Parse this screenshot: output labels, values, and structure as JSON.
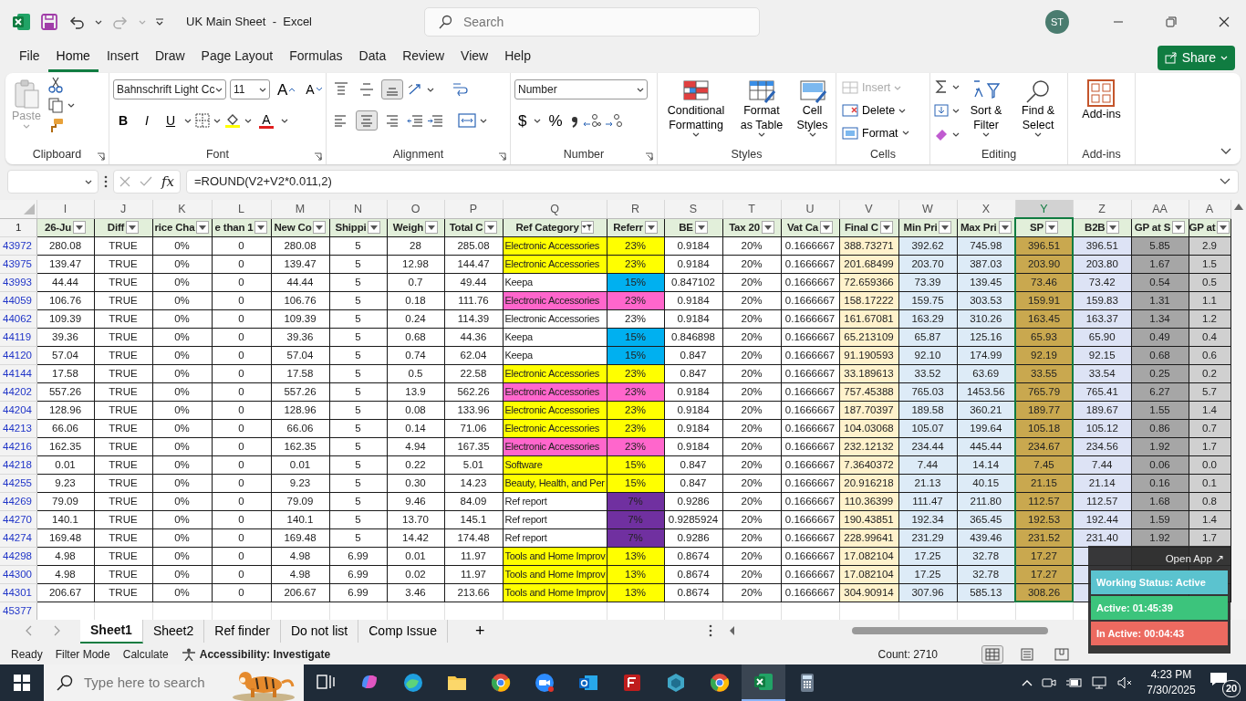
{
  "title_bar": {
    "title": "UK Main Sheet  -  Excel",
    "search_placeholder": "Search",
    "account_initials": "ST"
  },
  "menu": [
    {
      "label": "File",
      "selected": false
    },
    {
      "label": "Home",
      "selected": true
    },
    {
      "label": "Insert",
      "selected": false
    },
    {
      "label": "Draw",
      "selected": false
    },
    {
      "label": "Page Layout",
      "selected": false
    },
    {
      "label": "Formulas",
      "selected": false
    },
    {
      "label": "Data",
      "selected": false
    },
    {
      "label": "Review",
      "selected": false
    },
    {
      "label": "View",
      "selected": false
    },
    {
      "label": "Help",
      "selected": false
    }
  ],
  "share": "Share",
  "ribbon": {
    "groups": [
      {
        "label": "Clipboard"
      },
      {
        "label": "Font"
      },
      {
        "label": "Alignment"
      },
      {
        "label": "Number"
      },
      {
        "label": "Styles"
      },
      {
        "label": "Cells"
      },
      {
        "label": "Editing"
      },
      {
        "label": "Add-ins"
      }
    ],
    "paste": "Paste",
    "font_name": "Bahnschrift Light Cc",
    "font_size": "11",
    "size_buttons": [
      "A",
      "A"
    ],
    "font_styles": [
      "B",
      "I",
      "U"
    ],
    "font_color": "A",
    "vertical_align": [
      {
        "selected": false
      },
      {
        "selected": false
      },
      {
        "selected": true
      }
    ],
    "horizontal_align": [
      {
        "selected": false
      },
      {
        "selected": true
      },
      {
        "selected": false
      }
    ],
    "number_format": "Number",
    "currency": "$",
    "percent": "%",
    "styles": [
      {
        "label": "Conditional Formatting"
      },
      {
        "label": "Format as Table"
      },
      {
        "label": "Cell Styles"
      }
    ],
    "cells": [
      {
        "label": "Insert",
        "disabled": true
      },
      {
        "label": "Delete",
        "disabled": false
      },
      {
        "label": "Format",
        "disabled": false
      }
    ],
    "editing": [
      {
        "label": "Sort & Filter"
      },
      {
        "label": "Find & Select"
      }
    ],
    "addins": "Add-ins"
  },
  "formula_bar": {
    "function_label": "fx",
    "formula": "=ROUND(V2+V2*0.011,2)"
  },
  "grid": {
    "columns": [
      {
        "letter": "I",
        "header": "26-Ju",
        "filtered": false,
        "selected": false
      },
      {
        "letter": "J",
        "header": "Diff",
        "filtered": false,
        "selected": false
      },
      {
        "letter": "K",
        "header": "rice Cha",
        "filtered": false,
        "selected": false
      },
      {
        "letter": "L",
        "header": "e than 1",
        "filtered": false,
        "selected": false
      },
      {
        "letter": "M",
        "header": "New Co",
        "filtered": false,
        "selected": false
      },
      {
        "letter": "N",
        "header": "Shippi",
        "filtered": false,
        "selected": false
      },
      {
        "letter": "O",
        "header": "Weigh",
        "filtered": false,
        "selected": false
      },
      {
        "letter": "P",
        "header": "Total C",
        "filtered": false,
        "selected": false
      },
      {
        "letter": "Q",
        "header": "Ref Category",
        "filtered": true,
        "selected": false
      },
      {
        "letter": "R",
        "header": "Referr",
        "filtered": false,
        "selected": false
      },
      {
        "letter": "S",
        "header": "BE",
        "filtered": false,
        "selected": false
      },
      {
        "letter": "T",
        "header": "Tax 20",
        "filtered": false,
        "selected": false
      },
      {
        "letter": "U",
        "header": "Vat Ca",
        "filtered": false,
        "selected": false
      },
      {
        "letter": "V",
        "header": "Final C",
        "filtered": false,
        "selected": false,
        "color": "#fff2cc"
      },
      {
        "letter": "W",
        "header": "Min Pri",
        "filtered": false,
        "selected": false,
        "color": "#ddebf7"
      },
      {
        "letter": "X",
        "header": "Max Pri",
        "filtered": false,
        "selected": false,
        "color": "#ddebf7"
      },
      {
        "letter": "Y",
        "header": "SP",
        "filtered": false,
        "selected": true,
        "color": "#c9a84f"
      },
      {
        "letter": "Z",
        "header": "B2B",
        "filtered": false,
        "selected": false,
        "color": "#dde3f5"
      },
      {
        "letter": "AA",
        "header": "GP at S",
        "filtered": false,
        "selected": false,
        "color": "#a6a6a6"
      },
      {
        "letter": "A",
        "header": "GP at",
        "filtered": false,
        "selected": false,
        "color": "#d0d0d0"
      }
    ],
    "header_row": "1",
    "rows": [
      {
        "number": "43972",
        "cells": [
          "280.08",
          "TRUE",
          "0%",
          "0",
          "280.08",
          "5",
          "28",
          "285.08",
          {
            "text": "Electronic Accessories",
            "color": "#ffff00"
          },
          {
            "text": "23%",
            "color": "#ffff00"
          },
          "0.9184",
          "20%",
          "0.1666667",
          "388.73271",
          "392.62",
          "745.98",
          "396.51",
          "396.51",
          "5.85",
          "2.9"
        ]
      },
      {
        "number": "43975",
        "cells": [
          "139.47",
          "TRUE",
          "0%",
          "0",
          "139.47",
          "5",
          "12.98",
          "144.47",
          {
            "text": "Electronic Accessories",
            "color": "#ffff00"
          },
          {
            "text": "23%",
            "color": "#ffff00"
          },
          "0.9184",
          "20%",
          "0.1666667",
          "201.68499",
          "203.70",
          "387.03",
          "203.90",
          "203.80",
          "1.67",
          "1.5"
        ]
      },
      {
        "number": "43993",
        "cells": [
          "44.44",
          "TRUE",
          "0%",
          "0",
          "44.44",
          "5",
          "0.7",
          "49.44",
          {
            "text": "Keepa"
          },
          {
            "text": "15%",
            "color": "#00b0f0"
          },
          "0.847102",
          "20%",
          "0.1666667",
          "72.659366",
          "73.39",
          "139.45",
          "73.46",
          "73.42",
          "0.54",
          "0.5"
        ]
      },
      {
        "number": "44059",
        "cells": [
          "106.76",
          "TRUE",
          "0%",
          "0",
          "106.76",
          "5",
          "0.18",
          "111.76",
          {
            "text": "Electronic Accessories",
            "color": "#ff66cc"
          },
          {
            "text": "23%",
            "color": "#ff66cc"
          },
          "0.9184",
          "20%",
          "0.1666667",
          "158.17222",
          "159.75",
          "303.53",
          "159.91",
          "159.83",
          "1.31",
          "1.1"
        ]
      },
      {
        "number": "44062",
        "cells": [
          "109.39",
          "TRUE",
          "0%",
          "0",
          "109.39",
          "5",
          "0.24",
          "114.39",
          {
            "text": "Electronic Accessories"
          },
          {
            "text": "23%"
          },
          "0.9184",
          "20%",
          "0.1666667",
          "161.67081",
          "163.29",
          "310.26",
          "163.45",
          "163.37",
          "1.34",
          "1.2"
        ]
      },
      {
        "number": "44119",
        "cells": [
          "39.36",
          "TRUE",
          "0%",
          "0",
          "39.36",
          "5",
          "0.68",
          "44.36",
          {
            "text": "Keepa"
          },
          {
            "text": "15%",
            "color": "#00b0f0"
          },
          "0.846898",
          "20%",
          "0.1666667",
          "65.213109",
          "65.87",
          "125.16",
          "65.93",
          "65.90",
          "0.49",
          "0.4"
        ]
      },
      {
        "number": "44120",
        "cells": [
          "57.04",
          "TRUE",
          "0%",
          "0",
          "57.04",
          "5",
          "0.74",
          "62.04",
          {
            "text": "Keepa"
          },
          {
            "text": "15%",
            "color": "#00b0f0"
          },
          "0.847",
          "20%",
          "0.1666667",
          "91.190593",
          "92.10",
          "174.99",
          "92.19",
          "92.15",
          "0.68",
          "0.6"
        ]
      },
      {
        "number": "44144",
        "cells": [
          "17.58",
          "TRUE",
          "0%",
          "0",
          "17.58",
          "5",
          "0.5",
          "22.58",
          {
            "text": "Electronic Accessories",
            "color": "#ffff00"
          },
          {
            "text": "23%",
            "color": "#ffff00"
          },
          "0.847",
          "20%",
          "0.1666667",
          "33.189613",
          "33.52",
          "63.69",
          "33.55",
          "33.54",
          "0.25",
          "0.2"
        ]
      },
      {
        "number": "44202",
        "cells": [
          "557.26",
          "TRUE",
          "0%",
          "0",
          "557.26",
          "5",
          "13.9",
          "562.26",
          {
            "text": "Electronic Accessories",
            "color": "#ff66cc"
          },
          {
            "text": "23%",
            "color": "#ff66cc"
          },
          "0.9184",
          "20%",
          "0.1666667",
          "757.45388",
          "765.03",
          "1453.56",
          "765.79",
          "765.41",
          "6.27",
          "5.7"
        ]
      },
      {
        "number": "44204",
        "cells": [
          "128.96",
          "TRUE",
          "0%",
          "0",
          "128.96",
          "5",
          "0.08",
          "133.96",
          {
            "text": "Electronic Accessories",
            "color": "#ffff00"
          },
          {
            "text": "23%",
            "color": "#ffff00"
          },
          "0.9184",
          "20%",
          "0.1666667",
          "187.70397",
          "189.58",
          "360.21",
          "189.77",
          "189.67",
          "1.55",
          "1.4"
        ]
      },
      {
        "number": "44213",
        "cells": [
          "66.06",
          "TRUE",
          "0%",
          "0",
          "66.06",
          "5",
          "0.14",
          "71.06",
          {
            "text": "Electronic Accessories",
            "color": "#ffff00"
          },
          {
            "text": "23%",
            "color": "#ffff00"
          },
          "0.9184",
          "20%",
          "0.1666667",
          "104.03068",
          "105.07",
          "199.64",
          "105.18",
          "105.12",
          "0.86",
          "0.7"
        ]
      },
      {
        "number": "44216",
        "cells": [
          "162.35",
          "TRUE",
          "0%",
          "0",
          "162.35",
          "5",
          "4.94",
          "167.35",
          {
            "text": "Electronic Accessories",
            "color": "#ff66cc"
          },
          {
            "text": "23%",
            "color": "#ff66cc"
          },
          "0.9184",
          "20%",
          "0.1666667",
          "232.12132",
          "234.44",
          "445.44",
          "234.67",
          "234.56",
          "1.92",
          "1.7"
        ]
      },
      {
        "number": "44218",
        "cells": [
          "0.01",
          "TRUE",
          "0%",
          "0",
          "0.01",
          "5",
          "0.22",
          "5.01",
          {
            "text": "Software",
            "color": "#ffff00"
          },
          {
            "text": "15%",
            "color": "#ffff00"
          },
          "0.847",
          "20%",
          "0.1666667",
          "7.3640372",
          "7.44",
          "14.14",
          "7.45",
          "7.44",
          "0.06",
          "0.0"
        ]
      },
      {
        "number": "44255",
        "cells": [
          "9.23",
          "TRUE",
          "0%",
          "0",
          "9.23",
          "5",
          "0.30",
          "14.23",
          {
            "text": "Beauty, Health, and Per",
            "color": "#ffff00"
          },
          {
            "text": "15%",
            "color": "#ffff00"
          },
          "0.847",
          "20%",
          "0.1666667",
          "20.916218",
          "21.13",
          "40.15",
          "21.15",
          "21.14",
          "0.16",
          "0.1"
        ]
      },
      {
        "number": "44269",
        "cells": [
          "79.09",
          "TRUE",
          "0%",
          "0",
          "79.09",
          "5",
          "9.46",
          "84.09",
          {
            "text": "Ref report"
          },
          {
            "text": "7%",
            "color": "#7030a0"
          },
          "0.9286",
          "20%",
          "0.1666667",
          "110.36399",
          "111.47",
          "211.80",
          "112.57",
          "112.57",
          "1.68",
          "0.8"
        ]
      },
      {
        "number": "44270",
        "cells": [
          "140.1",
          "TRUE",
          "0%",
          "0",
          "140.1",
          "5",
          "13.70",
          "145.1",
          {
            "text": "Ref report"
          },
          {
            "text": "7%",
            "color": "#7030a0"
          },
          "0.9285924",
          "20%",
          "0.1666667",
          "190.43851",
          "192.34",
          "365.45",
          "192.53",
          "192.44",
          "1.59",
          "1.4"
        ]
      },
      {
        "number": "44274",
        "cells": [
          "169.48",
          "TRUE",
          "0%",
          "0",
          "169.48",
          "5",
          "14.42",
          "174.48",
          {
            "text": "Ref report"
          },
          {
            "text": "7%",
            "color": "#7030a0"
          },
          "0.9286",
          "20%",
          "0.1666667",
          "228.99641",
          "231.29",
          "439.46",
          "231.52",
          "231.40",
          "1.92",
          "1.7"
        ]
      },
      {
        "number": "44298",
        "cells": [
          "4.98",
          "TRUE",
          "0%",
          "0",
          "4.98",
          "6.99",
          "0.01",
          "11.97",
          {
            "text": "Tools and Home Improv",
            "color": "#ffff00"
          },
          {
            "text": "13%",
            "color": "#ffff00"
          },
          "0.8674",
          "20%",
          "0.1666667",
          "17.082104",
          "17.25",
          "32.78",
          "17.27",
          null,
          null,
          null
        ]
      },
      {
        "number": "44300",
        "cells": [
          "4.98",
          "TRUE",
          "0%",
          "0",
          "4.98",
          "6.99",
          "0.02",
          "11.97",
          {
            "text": "Tools and Home Improv",
            "color": "#ffff00"
          },
          {
            "text": "13%",
            "color": "#ffff00"
          },
          "0.8674",
          "20%",
          "0.1666667",
          "17.082104",
          "17.25",
          "32.78",
          "17.27",
          null,
          null,
          null
        ]
      },
      {
        "number": "44301",
        "cells": [
          "206.67",
          "TRUE",
          "0%",
          "0",
          "206.67",
          "6.99",
          "3.46",
          "213.66",
          {
            "text": "Tools and Home Improv",
            "color": "#ffff00"
          },
          {
            "text": "13%",
            "color": "#ffff00"
          },
          "0.8674",
          "20%",
          "0.1666667",
          "304.90914",
          "307.96",
          "585.13",
          "308.26",
          null,
          null,
          null
        ]
      }
    ],
    "last_row": "45377"
  },
  "sheets": [
    {
      "label": "Sheet1",
      "selected": true
    },
    {
      "label": "Sheet2",
      "selected": false
    },
    {
      "label": "Ref finder",
      "selected": false
    },
    {
      "label": "Do not list",
      "selected": false
    },
    {
      "label": "Comp Issue",
      "selected": false
    }
  ],
  "add_sheet": "+",
  "status_bar": {
    "items": [
      "Ready",
      "Filter Mode",
      "Calculate"
    ],
    "accessibility": "Accessibility: Investigate",
    "count": "Count: 2710",
    "views": [
      {
        "selected": true
      },
      {
        "selected": false
      },
      {
        "selected": false
      }
    ]
  },
  "widget": {
    "open_app": "Open App ↗",
    "items": [
      {
        "label": "Working Status: Active",
        "color": "#5bc3cf"
      },
      {
        "label": "Active: 01:45:39",
        "color": "#3cc47c"
      },
      {
        "label": "In Active: 00:04:43",
        "color": "#ec6a60"
      }
    ]
  },
  "taskbar": {
    "search_placeholder": "Type here to search",
    "apps": [
      {
        "kind": "taskview",
        "selected": false
      },
      {
        "kind": "copilot",
        "selected": false
      },
      {
        "kind": "edge",
        "selected": false
      },
      {
        "kind": "folder",
        "selected": false
      },
      {
        "kind": "chrome",
        "selected": false
      },
      {
        "kind": "zoom",
        "selected": false
      },
      {
        "kind": "outlook",
        "selected": false
      },
      {
        "kind": "filezilla",
        "selected": false
      },
      {
        "kind": "cube",
        "selected": false
      },
      {
        "kind": "chrome",
        "selected": false
      },
      {
        "kind": "excel",
        "selected": true
      },
      {
        "kind": "calculator",
        "selected": false
      }
    ],
    "time": "4:23 PM",
    "date": "7/30/2025",
    "notifications": "20"
  }
}
